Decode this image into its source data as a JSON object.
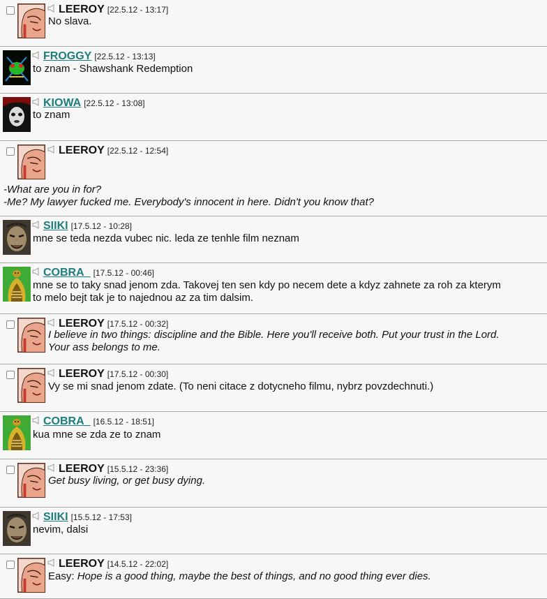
{
  "posts": [
    {
      "user": "LEEROY",
      "time": "[22.5.12 - 13:17]",
      "lines": [
        {
          "text": "No slava."
        }
      ]
    },
    {
      "user": "FROGGY",
      "time": "[22.5.12 - 13:13]",
      "lines": [
        {
          "text": "to znam - Shawshank Redemption"
        }
      ]
    },
    {
      "user": "KIOWA",
      "time": "[22.5.12 - 13:08]",
      "lines": [
        {
          "text": "to znam"
        }
      ]
    },
    {
      "user": "LEEROY",
      "time": "[22.5.12 - 12:54]",
      "lines": [
        {
          "text": "-What are you in for?",
          "italic": true
        },
        {
          "text": "-Me? My lawyer fucked me. Everybody's innocent in here. Didn't you know that?",
          "italic": true
        }
      ]
    },
    {
      "user": "SIIKI",
      "time": "[17.5.12 - 10:28]",
      "lines": [
        {
          "text": "mne se teda nezda vubec nic. leda ze tenhle film neznam"
        }
      ]
    },
    {
      "user": "COBRA_",
      "time": "[17.5.12 - 00:46]",
      "lines": [
        {
          "text": "mne se to taky snad jenom zda. Takovej ten sen kdy po necem dete a kdyz zahnete za roh za kterym"
        },
        {
          "text": "to melo bejt tak je to najednou az za tim dalsim."
        }
      ]
    },
    {
      "user": "LEEROY",
      "time": "[17.5.12 - 00:32]",
      "lines": [
        {
          "text": "I believe in two things: discipline and the Bible. Here you'll receive both. Put your trust in the Lord.",
          "italic": true
        },
        {
          "text": "Your ass belongs to me.",
          "italic": true
        }
      ]
    },
    {
      "user": "LEEROY",
      "time": "[17.5.12 - 00:30]",
      "lines": [
        {
          "text": "Vy se mi snad jenom zdate. (To neni citace z dotycneho filmu, nybrz povzdechnuti.)"
        }
      ]
    },
    {
      "user": "COBRA_",
      "time": "[16.5.12 - 18:51]",
      "lines": [
        {
          "text": "kua mne se zda ze to znam"
        }
      ]
    },
    {
      "user": "LEEROY",
      "time": "[15.5.12 - 23:36]",
      "lines": [
        {
          "text": "Get busy living, or get busy dying.",
          "italic": true
        }
      ]
    },
    {
      "user": "SIIKI",
      "time": "[15.5.12 - 17:53]",
      "lines": [
        {
          "text": "nevim, dalsi"
        }
      ]
    },
    {
      "user": "LEEROY",
      "time": "[14.5.12 - 22:02]",
      "lines": [
        {
          "text": "Easy: ",
          "rest": "Hope is a good thing, maybe the best of things, and no good thing ever dies."
        }
      ]
    }
  ]
}
